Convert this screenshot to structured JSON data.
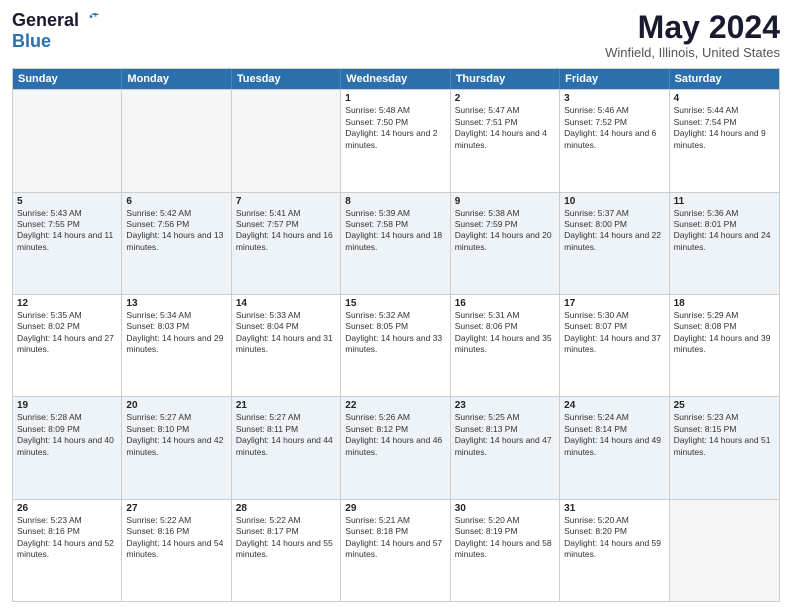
{
  "header": {
    "logo_general": "General",
    "logo_blue": "Blue",
    "title": "May 2024",
    "location": "Winfield, Illinois, United States"
  },
  "calendar": {
    "days_of_week": [
      "Sunday",
      "Monday",
      "Tuesday",
      "Wednesday",
      "Thursday",
      "Friday",
      "Saturday"
    ],
    "rows": [
      [
        {
          "day": "",
          "empty": true
        },
        {
          "day": "",
          "empty": true
        },
        {
          "day": "",
          "empty": true
        },
        {
          "day": "1",
          "sunrise": "5:48 AM",
          "sunset": "7:50 PM",
          "daylight": "14 hours and 2 minutes."
        },
        {
          "day": "2",
          "sunrise": "5:47 AM",
          "sunset": "7:51 PM",
          "daylight": "14 hours and 4 minutes."
        },
        {
          "day": "3",
          "sunrise": "5:46 AM",
          "sunset": "7:52 PM",
          "daylight": "14 hours and 6 minutes."
        },
        {
          "day": "4",
          "sunrise": "5:44 AM",
          "sunset": "7:54 PM",
          "daylight": "14 hours and 9 minutes."
        }
      ],
      [
        {
          "day": "5",
          "sunrise": "5:43 AM",
          "sunset": "7:55 PM",
          "daylight": "14 hours and 11 minutes."
        },
        {
          "day": "6",
          "sunrise": "5:42 AM",
          "sunset": "7:56 PM",
          "daylight": "14 hours and 13 minutes."
        },
        {
          "day": "7",
          "sunrise": "5:41 AM",
          "sunset": "7:57 PM",
          "daylight": "14 hours and 16 minutes."
        },
        {
          "day": "8",
          "sunrise": "5:39 AM",
          "sunset": "7:58 PM",
          "daylight": "14 hours and 18 minutes."
        },
        {
          "day": "9",
          "sunrise": "5:38 AM",
          "sunset": "7:59 PM",
          "daylight": "14 hours and 20 minutes."
        },
        {
          "day": "10",
          "sunrise": "5:37 AM",
          "sunset": "8:00 PM",
          "daylight": "14 hours and 22 minutes."
        },
        {
          "day": "11",
          "sunrise": "5:36 AM",
          "sunset": "8:01 PM",
          "daylight": "14 hours and 24 minutes."
        }
      ],
      [
        {
          "day": "12",
          "sunrise": "5:35 AM",
          "sunset": "8:02 PM",
          "daylight": "14 hours and 27 minutes."
        },
        {
          "day": "13",
          "sunrise": "5:34 AM",
          "sunset": "8:03 PM",
          "daylight": "14 hours and 29 minutes."
        },
        {
          "day": "14",
          "sunrise": "5:33 AM",
          "sunset": "8:04 PM",
          "daylight": "14 hours and 31 minutes."
        },
        {
          "day": "15",
          "sunrise": "5:32 AM",
          "sunset": "8:05 PM",
          "daylight": "14 hours and 33 minutes."
        },
        {
          "day": "16",
          "sunrise": "5:31 AM",
          "sunset": "8:06 PM",
          "daylight": "14 hours and 35 minutes."
        },
        {
          "day": "17",
          "sunrise": "5:30 AM",
          "sunset": "8:07 PM",
          "daylight": "14 hours and 37 minutes."
        },
        {
          "day": "18",
          "sunrise": "5:29 AM",
          "sunset": "8:08 PM",
          "daylight": "14 hours and 39 minutes."
        }
      ],
      [
        {
          "day": "19",
          "sunrise": "5:28 AM",
          "sunset": "8:09 PM",
          "daylight": "14 hours and 40 minutes."
        },
        {
          "day": "20",
          "sunrise": "5:27 AM",
          "sunset": "8:10 PM",
          "daylight": "14 hours and 42 minutes."
        },
        {
          "day": "21",
          "sunrise": "5:27 AM",
          "sunset": "8:11 PM",
          "daylight": "14 hours and 44 minutes."
        },
        {
          "day": "22",
          "sunrise": "5:26 AM",
          "sunset": "8:12 PM",
          "daylight": "14 hours and 46 minutes."
        },
        {
          "day": "23",
          "sunrise": "5:25 AM",
          "sunset": "8:13 PM",
          "daylight": "14 hours and 47 minutes."
        },
        {
          "day": "24",
          "sunrise": "5:24 AM",
          "sunset": "8:14 PM",
          "daylight": "14 hours and 49 minutes."
        },
        {
          "day": "25",
          "sunrise": "5:23 AM",
          "sunset": "8:15 PM",
          "daylight": "14 hours and 51 minutes."
        }
      ],
      [
        {
          "day": "26",
          "sunrise": "5:23 AM",
          "sunset": "8:16 PM",
          "daylight": "14 hours and 52 minutes."
        },
        {
          "day": "27",
          "sunrise": "5:22 AM",
          "sunset": "8:16 PM",
          "daylight": "14 hours and 54 minutes."
        },
        {
          "day": "28",
          "sunrise": "5:22 AM",
          "sunset": "8:17 PM",
          "daylight": "14 hours and 55 minutes."
        },
        {
          "day": "29",
          "sunrise": "5:21 AM",
          "sunset": "8:18 PM",
          "daylight": "14 hours and 57 minutes."
        },
        {
          "day": "30",
          "sunrise": "5:20 AM",
          "sunset": "8:19 PM",
          "daylight": "14 hours and 58 minutes."
        },
        {
          "day": "31",
          "sunrise": "5:20 AM",
          "sunset": "8:20 PM",
          "daylight": "14 hours and 59 minutes."
        },
        {
          "day": "",
          "empty": true
        }
      ]
    ]
  }
}
